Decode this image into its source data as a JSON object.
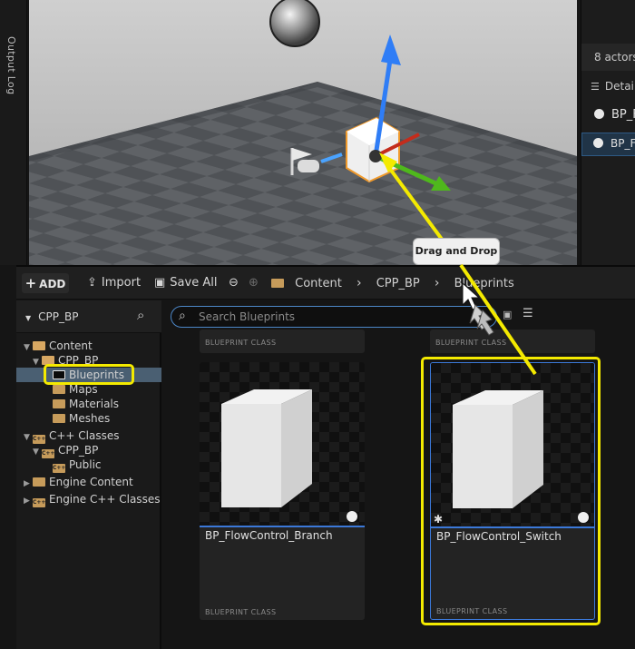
{
  "left_tab": {
    "output_log": "Output Log"
  },
  "outliner": {
    "actors_count": "8 actors",
    "details_tab": "Details",
    "selected_actor": "BP_FlowControl_Switch",
    "component_row": "BP_FlowControl_Switch (Self)"
  },
  "viewport": {
    "tooltip": "Drag and Drop"
  },
  "toolbar": {
    "add_label": "ADD",
    "import_label": "Import",
    "save_all_label": "Save All",
    "breadcrumb": [
      "Content",
      "CPP_BP",
      "Blueprints"
    ]
  },
  "sources": {
    "title": "CPP_BP",
    "tree": [
      {
        "label": "Content",
        "level": 0,
        "expanded": true
      },
      {
        "label": "CPP_BP",
        "level": 1,
        "expanded": true
      },
      {
        "label": "Blueprints",
        "level": 2,
        "selected": true
      },
      {
        "label": "Maps",
        "level": 2
      },
      {
        "label": "Materials",
        "level": 2
      },
      {
        "label": "Meshes",
        "level": 2
      },
      {
        "label": "C++ Classes",
        "level": 0,
        "expanded": true
      },
      {
        "label": "CPP_BP",
        "level": 1,
        "expanded": true
      },
      {
        "label": "Public",
        "level": 2
      },
      {
        "label": "Engine Content",
        "level": 0
      },
      {
        "label": "Engine C++ Classes",
        "level": 0
      }
    ]
  },
  "assets": {
    "search_placeholder": "Search Blueprints",
    "top_row_class": "BLUEPRINT CLASS",
    "items": [
      {
        "name": "BP_FlowControl_Branch",
        "class": "BLUEPRINT CLASS"
      },
      {
        "name": "BP_FlowControl_Switch",
        "class": "BLUEPRINT CLASS"
      }
    ]
  },
  "colors": {
    "accent_blue": "#3b78d8",
    "highlight_yellow": "#f4ea00",
    "selection_bg": "#4a5f72"
  }
}
